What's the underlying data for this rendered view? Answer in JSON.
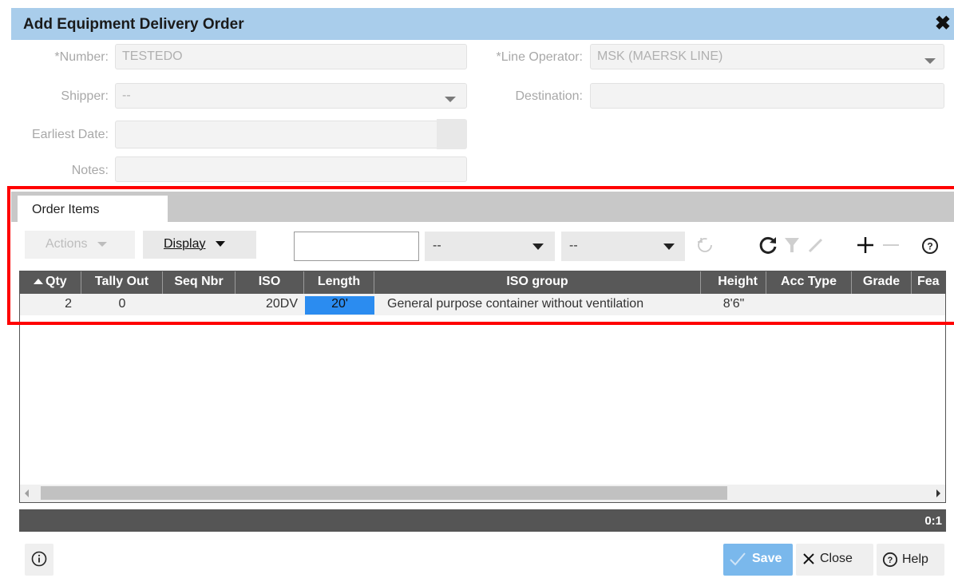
{
  "dialog": {
    "title": "Add Equipment Delivery Order"
  },
  "form": {
    "number_label": "*Number:",
    "number_value": "TESTEDO",
    "line_operator_label": "*Line Operator:",
    "line_operator_value": "MSK (MAERSK LINE)",
    "shipper_label": "Shipper:",
    "shipper_value": "--",
    "destination_label": "Destination:",
    "destination_value": "",
    "earliest_date_label": "Earliest Date:",
    "earliest_date_value": "",
    "notes_label": "Notes:",
    "notes_value": ""
  },
  "tabs": [
    {
      "label": "Order Items"
    }
  ],
  "toolbar": {
    "actions_label": "Actions",
    "display_label": "Display",
    "filter_value": "",
    "select1_value": "--",
    "select2_value": "--"
  },
  "grid": {
    "columns": [
      "Qty",
      "Tally Out",
      "Seq Nbr",
      "ISO",
      "Length",
      "ISO group",
      "Height",
      "Acc Type",
      "Grade",
      "Fea"
    ],
    "rows": [
      {
        "qty": "2",
        "tally_out": "0",
        "seq_nbr": "",
        "iso": "20DV",
        "length": "20'",
        "iso_group": "General purpose container without ventilation",
        "height": "8'6\"",
        "acc_type": "",
        "grade": ""
      }
    ]
  },
  "status": {
    "count": "0:1"
  },
  "footer": {
    "save_label": "Save",
    "close_label": "Close",
    "help_label": "Help"
  },
  "colors": {
    "title_bar": "#a9cdeb",
    "grid_header": "#585858",
    "selected_cell": "#2b8cf0",
    "save_button": "#7ab8ec",
    "highlight_box": "#ff0000"
  }
}
